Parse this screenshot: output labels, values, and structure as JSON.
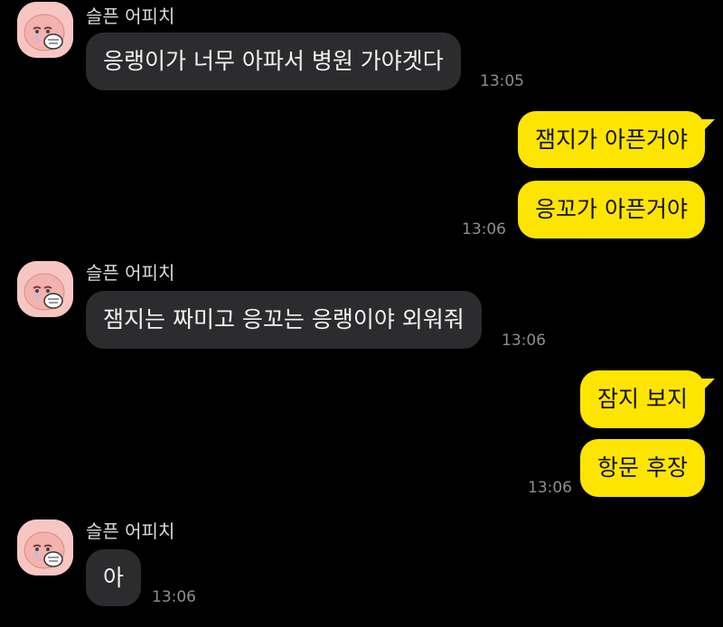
{
  "chat": {
    "colors": {
      "background": "#000000",
      "incoming_bubble": "#2c2c2e",
      "outgoing_bubble": "#fee500",
      "avatar": "#f7c6c3"
    },
    "groups": [
      {
        "sender": "슬픈 어피치",
        "avatar_icon": "sad-apeach-avatar-icon",
        "message": "응랭이가 너무 아파서 병원 가야겟다",
        "time": "13:05"
      },
      {
        "outgoing": [
          "잼지가 아픈거야",
          "응꼬가 아픈거야"
        ],
        "time": "13:06"
      },
      {
        "sender": "슬픈 어피치",
        "avatar_icon": "sad-apeach-avatar-icon",
        "message": "잼지는 짜미고 응꼬는 응랭이야 외워줘",
        "time": "13:06"
      },
      {
        "outgoing": [
          "잠지 보지",
          "항문 후장"
        ],
        "time": "13:06"
      },
      {
        "sender": "슬픈 어피치",
        "avatar_icon": "sad-apeach-avatar-icon",
        "message": "아",
        "time": "13:06"
      }
    ]
  }
}
